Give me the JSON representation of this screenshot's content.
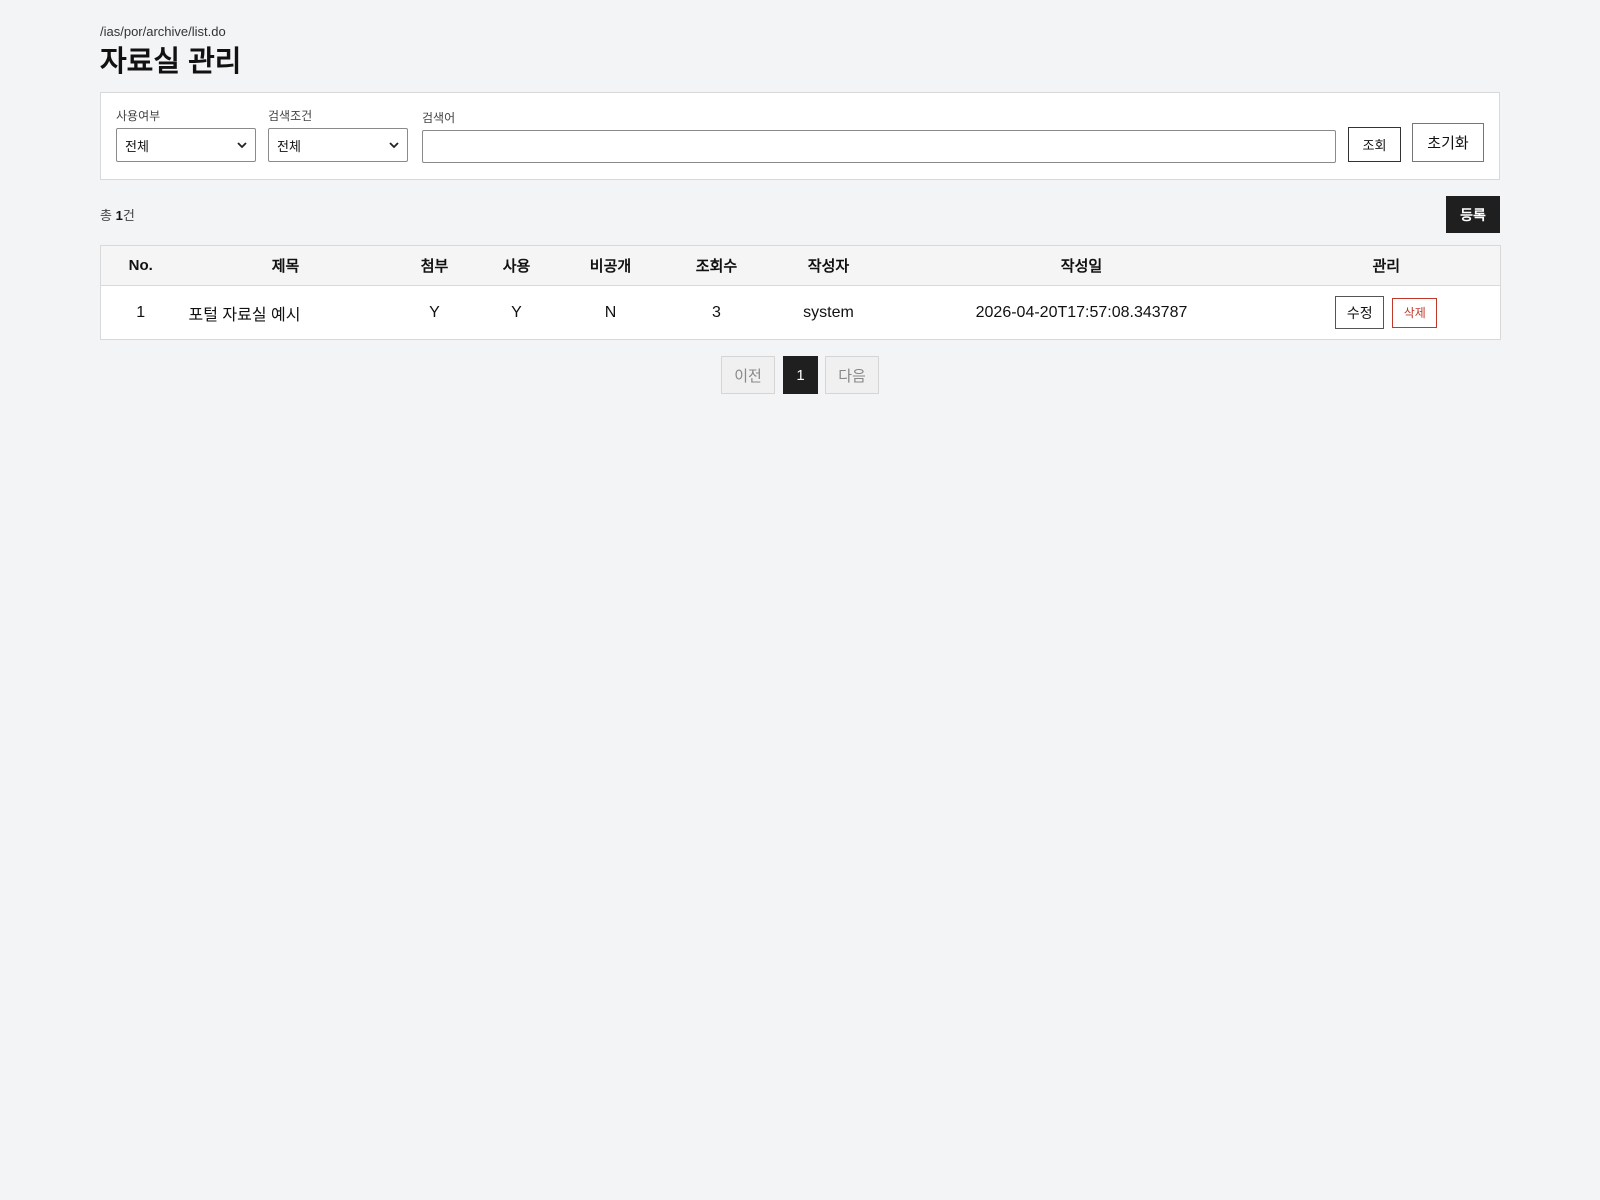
{
  "header": {
    "path": "/ias/por/archive/list.do",
    "title": "자료실 관리"
  },
  "search": {
    "use_label": "사용여부",
    "use_value": "전체",
    "cond_label": "검색조건",
    "cond_value": "전체",
    "keyword_label": "검색어",
    "keyword_value": "",
    "search_button": "조회",
    "reset_button": "초기화"
  },
  "summary": {
    "prefix": "총 ",
    "count": "1",
    "suffix": "건",
    "register_button": "등록"
  },
  "table": {
    "columns": [
      "No.",
      "제목",
      "첨부",
      "사용",
      "비공개",
      "조회수",
      "작성자",
      "작성일",
      "관리"
    ],
    "rows": [
      {
        "no": "1",
        "title": "포털 자료실 예시",
        "attach": "Y",
        "use": "Y",
        "private": "N",
        "views": "3",
        "author": "system",
        "created": "2026-04-20T17:57:08.343787",
        "edit_label": "수정",
        "delete_label": "삭제"
      }
    ]
  },
  "pagination": {
    "prev": "이전",
    "current": "1",
    "next": "다음"
  },
  "colors": {
    "background": "#f3f4f6",
    "primary_button": "#1f1f1f",
    "delete_accent": "#c0392b"
  },
  "icons": {
    "select_arrow": "chevron-down-icon"
  }
}
